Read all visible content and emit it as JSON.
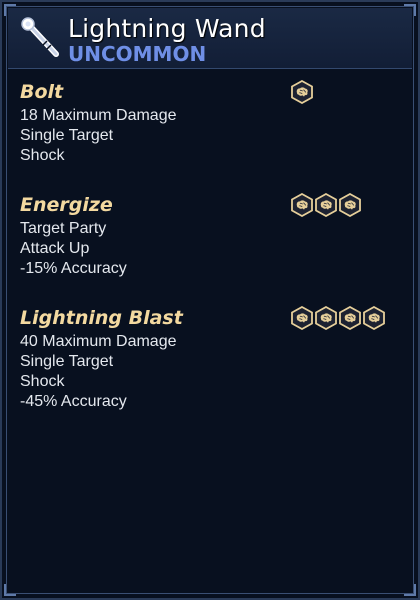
{
  "item": {
    "name": "Lightning Wand",
    "rarity": "UNCOMMON",
    "icon": "wand-icon"
  },
  "colors": {
    "rarity": "#6f8fe6",
    "ability_name": "#f3d9a0",
    "cost_icon_fill": "#e6cf9a",
    "background": "#08101f"
  },
  "abilities": [
    {
      "name": "Bolt",
      "cost": 1,
      "cost_icon": "brain-icon",
      "lines": [
        "18 Maximum Damage",
        "Single Target",
        "Shock"
      ]
    },
    {
      "name": "Energize",
      "cost": 3,
      "cost_icon": "brain-icon",
      "lines": [
        "Target Party",
        "Attack Up",
        "-15% Accuracy"
      ]
    },
    {
      "name": "Lightning Blast",
      "cost": 4,
      "cost_icon": "brain-icon",
      "lines": [
        "40 Maximum Damage",
        "Single Target",
        "Shock",
        "-45% Accuracy"
      ]
    }
  ]
}
